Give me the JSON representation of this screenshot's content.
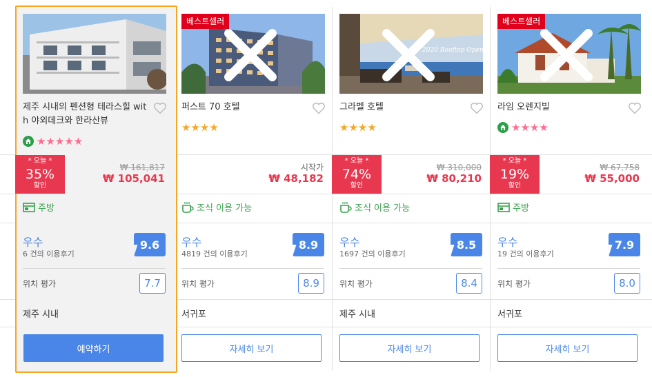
{
  "colors": {
    "accent": "#4a86e8",
    "sale": "#e8384f",
    "star": "#ff6c8d",
    "feature": "#35a14a",
    "selected_border": "#f5a623",
    "best_badge": "#e0001b"
  },
  "cards": [
    {
      "name": "제주 시내의 펜션형 테라스힐 with 야외데크와 한라산뷰",
      "best_seller": "",
      "stars": "★★★★★",
      "deal_today": "* 오늘 *",
      "deal_pct": "35%",
      "deal_off": "할인",
      "price_label": "",
      "price_old": "₩ 161,817",
      "price_new": "₩ 105,041",
      "feature": "주방",
      "feature_icon": "kitchen-icon",
      "rating_word": "우수",
      "reviews": "6 건의 이용후기",
      "score": "9.6",
      "loc_label": "위치 평가",
      "loc_score": "7.7",
      "area": "제주 시내",
      "button": "예약하기"
    },
    {
      "name": "퍼스트 70 호텔",
      "best_seller": "베스트셀러",
      "stars": "★★★★",
      "deal_today": "",
      "deal_pct": "",
      "deal_off": "",
      "price_label": "시작가",
      "price_old": "",
      "price_new": "₩ 48,182",
      "feature": "조식 이용 가능",
      "feature_icon": "breakfast-icon",
      "rating_word": "우수",
      "reviews": "4819 건의 이용후기",
      "score": "8.9",
      "loc_label": "위치 평가",
      "loc_score": "8.9",
      "area": "서귀포",
      "button": "자세히 보기"
    },
    {
      "name": "그라벨 호텔",
      "best_seller": "",
      "stars": "★★★★",
      "deal_today": "* 오늘 *",
      "deal_pct": "74%",
      "deal_off": "할인",
      "price_label": "",
      "price_old": "₩ 310,000",
      "price_new": "₩ 80,210",
      "feature": "조식 이용 가능",
      "feature_icon": "breakfast-icon",
      "rating_word": "우수",
      "reviews": "1697 건의 이용후기",
      "score": "8.5",
      "loc_label": "위치 평가",
      "loc_score": "8.4",
      "area": "제주 시내",
      "button": "자세히 보기",
      "photo_caption": "2020 Rooftop Open"
    },
    {
      "name": "라임 오렌지빌",
      "best_seller": "베스트셀러",
      "stars": "★★★★",
      "deal_today": "* 오늘 *",
      "deal_pct": "19%",
      "deal_off": "할인",
      "price_label": "",
      "price_old": "₩ 67,758",
      "price_new": "₩ 55,000",
      "feature": "주방",
      "feature_icon": "kitchen-icon",
      "rating_word": "우수",
      "reviews": "19 건의 이용후기",
      "score": "7.9",
      "loc_label": "위치 평가",
      "loc_score": "8.0",
      "area": "서귀포",
      "button": "자세히 보기"
    }
  ]
}
